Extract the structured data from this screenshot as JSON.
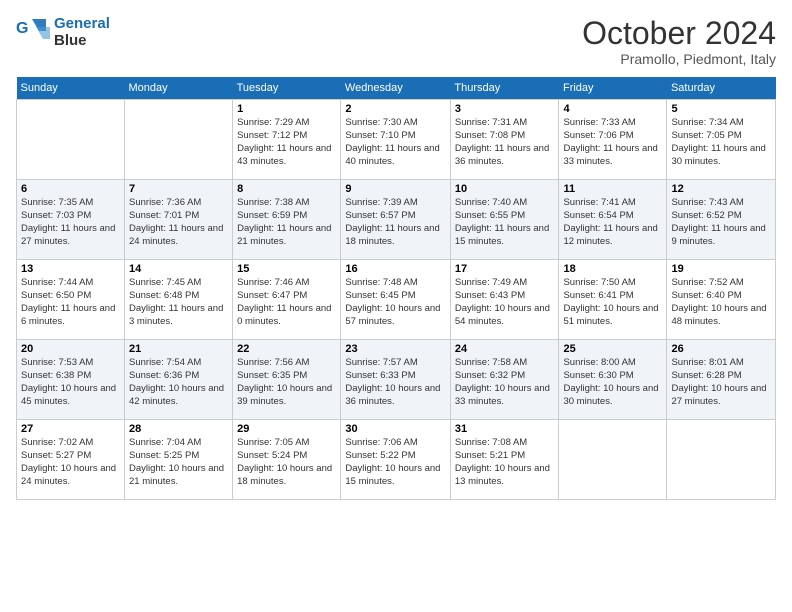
{
  "header": {
    "logo_line1": "General",
    "logo_line2": "Blue",
    "month": "October 2024",
    "location": "Pramollo, Piedmont, Italy"
  },
  "weekdays": [
    "Sunday",
    "Monday",
    "Tuesday",
    "Wednesday",
    "Thursday",
    "Friday",
    "Saturday"
  ],
  "weeks": [
    [
      {
        "day": "",
        "info": ""
      },
      {
        "day": "",
        "info": ""
      },
      {
        "day": "1",
        "info": "Sunrise: 7:29 AM\nSunset: 7:12 PM\nDaylight: 11 hours and 43 minutes."
      },
      {
        "day": "2",
        "info": "Sunrise: 7:30 AM\nSunset: 7:10 PM\nDaylight: 11 hours and 40 minutes."
      },
      {
        "day": "3",
        "info": "Sunrise: 7:31 AM\nSunset: 7:08 PM\nDaylight: 11 hours and 36 minutes."
      },
      {
        "day": "4",
        "info": "Sunrise: 7:33 AM\nSunset: 7:06 PM\nDaylight: 11 hours and 33 minutes."
      },
      {
        "day": "5",
        "info": "Sunrise: 7:34 AM\nSunset: 7:05 PM\nDaylight: 11 hours and 30 minutes."
      }
    ],
    [
      {
        "day": "6",
        "info": "Sunrise: 7:35 AM\nSunset: 7:03 PM\nDaylight: 11 hours and 27 minutes."
      },
      {
        "day": "7",
        "info": "Sunrise: 7:36 AM\nSunset: 7:01 PM\nDaylight: 11 hours and 24 minutes."
      },
      {
        "day": "8",
        "info": "Sunrise: 7:38 AM\nSunset: 6:59 PM\nDaylight: 11 hours and 21 minutes."
      },
      {
        "day": "9",
        "info": "Sunrise: 7:39 AM\nSunset: 6:57 PM\nDaylight: 11 hours and 18 minutes."
      },
      {
        "day": "10",
        "info": "Sunrise: 7:40 AM\nSunset: 6:55 PM\nDaylight: 11 hours and 15 minutes."
      },
      {
        "day": "11",
        "info": "Sunrise: 7:41 AM\nSunset: 6:54 PM\nDaylight: 11 hours and 12 minutes."
      },
      {
        "day": "12",
        "info": "Sunrise: 7:43 AM\nSunset: 6:52 PM\nDaylight: 11 hours and 9 minutes."
      }
    ],
    [
      {
        "day": "13",
        "info": "Sunrise: 7:44 AM\nSunset: 6:50 PM\nDaylight: 11 hours and 6 minutes."
      },
      {
        "day": "14",
        "info": "Sunrise: 7:45 AM\nSunset: 6:48 PM\nDaylight: 11 hours and 3 minutes."
      },
      {
        "day": "15",
        "info": "Sunrise: 7:46 AM\nSunset: 6:47 PM\nDaylight: 11 hours and 0 minutes."
      },
      {
        "day": "16",
        "info": "Sunrise: 7:48 AM\nSunset: 6:45 PM\nDaylight: 10 hours and 57 minutes."
      },
      {
        "day": "17",
        "info": "Sunrise: 7:49 AM\nSunset: 6:43 PM\nDaylight: 10 hours and 54 minutes."
      },
      {
        "day": "18",
        "info": "Sunrise: 7:50 AM\nSunset: 6:41 PM\nDaylight: 10 hours and 51 minutes."
      },
      {
        "day": "19",
        "info": "Sunrise: 7:52 AM\nSunset: 6:40 PM\nDaylight: 10 hours and 48 minutes."
      }
    ],
    [
      {
        "day": "20",
        "info": "Sunrise: 7:53 AM\nSunset: 6:38 PM\nDaylight: 10 hours and 45 minutes."
      },
      {
        "day": "21",
        "info": "Sunrise: 7:54 AM\nSunset: 6:36 PM\nDaylight: 10 hours and 42 minutes."
      },
      {
        "day": "22",
        "info": "Sunrise: 7:56 AM\nSunset: 6:35 PM\nDaylight: 10 hours and 39 minutes."
      },
      {
        "day": "23",
        "info": "Sunrise: 7:57 AM\nSunset: 6:33 PM\nDaylight: 10 hours and 36 minutes."
      },
      {
        "day": "24",
        "info": "Sunrise: 7:58 AM\nSunset: 6:32 PM\nDaylight: 10 hours and 33 minutes."
      },
      {
        "day": "25",
        "info": "Sunrise: 8:00 AM\nSunset: 6:30 PM\nDaylight: 10 hours and 30 minutes."
      },
      {
        "day": "26",
        "info": "Sunrise: 8:01 AM\nSunset: 6:28 PM\nDaylight: 10 hours and 27 minutes."
      }
    ],
    [
      {
        "day": "27",
        "info": "Sunrise: 7:02 AM\nSunset: 5:27 PM\nDaylight: 10 hours and 24 minutes."
      },
      {
        "day": "28",
        "info": "Sunrise: 7:04 AM\nSunset: 5:25 PM\nDaylight: 10 hours and 21 minutes."
      },
      {
        "day": "29",
        "info": "Sunrise: 7:05 AM\nSunset: 5:24 PM\nDaylight: 10 hours and 18 minutes."
      },
      {
        "day": "30",
        "info": "Sunrise: 7:06 AM\nSunset: 5:22 PM\nDaylight: 10 hours and 15 minutes."
      },
      {
        "day": "31",
        "info": "Sunrise: 7:08 AM\nSunset: 5:21 PM\nDaylight: 10 hours and 13 minutes."
      },
      {
        "day": "",
        "info": ""
      },
      {
        "day": "",
        "info": ""
      }
    ]
  ]
}
